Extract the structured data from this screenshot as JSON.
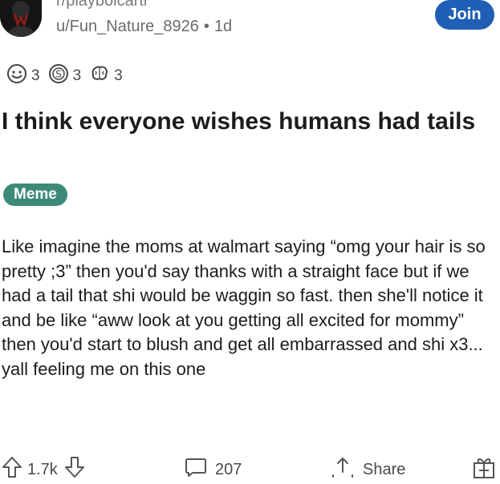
{
  "header": {
    "subreddit": "r/playboicarti",
    "username": "u/Fun_Nature_8926",
    "separator": "•",
    "age": "1d",
    "join_label": "Join"
  },
  "awards": [
    {
      "icon": "wholesome-award-icon",
      "count": "3"
    },
    {
      "icon": "silver-coin-award-icon",
      "count": "3"
    },
    {
      "icon": "brain-award-icon",
      "count": "3"
    }
  ],
  "post": {
    "title": "I think everyone wishes humans had tails",
    "flair": "Meme",
    "body": "Like imagine the moms at walmart saying “omg your hair is so pretty ;3” then you'd say thanks with a straight face but if we had a tail that shi would be waggin so fast. then she'll notice it and be like “aww look at you getting all excited for mommy” then you'd start to blush and get all embarrassed and shi x3... yall feeling me on this one"
  },
  "actions": {
    "score": "1.7k",
    "comments": "207",
    "share_label": "Share"
  }
}
